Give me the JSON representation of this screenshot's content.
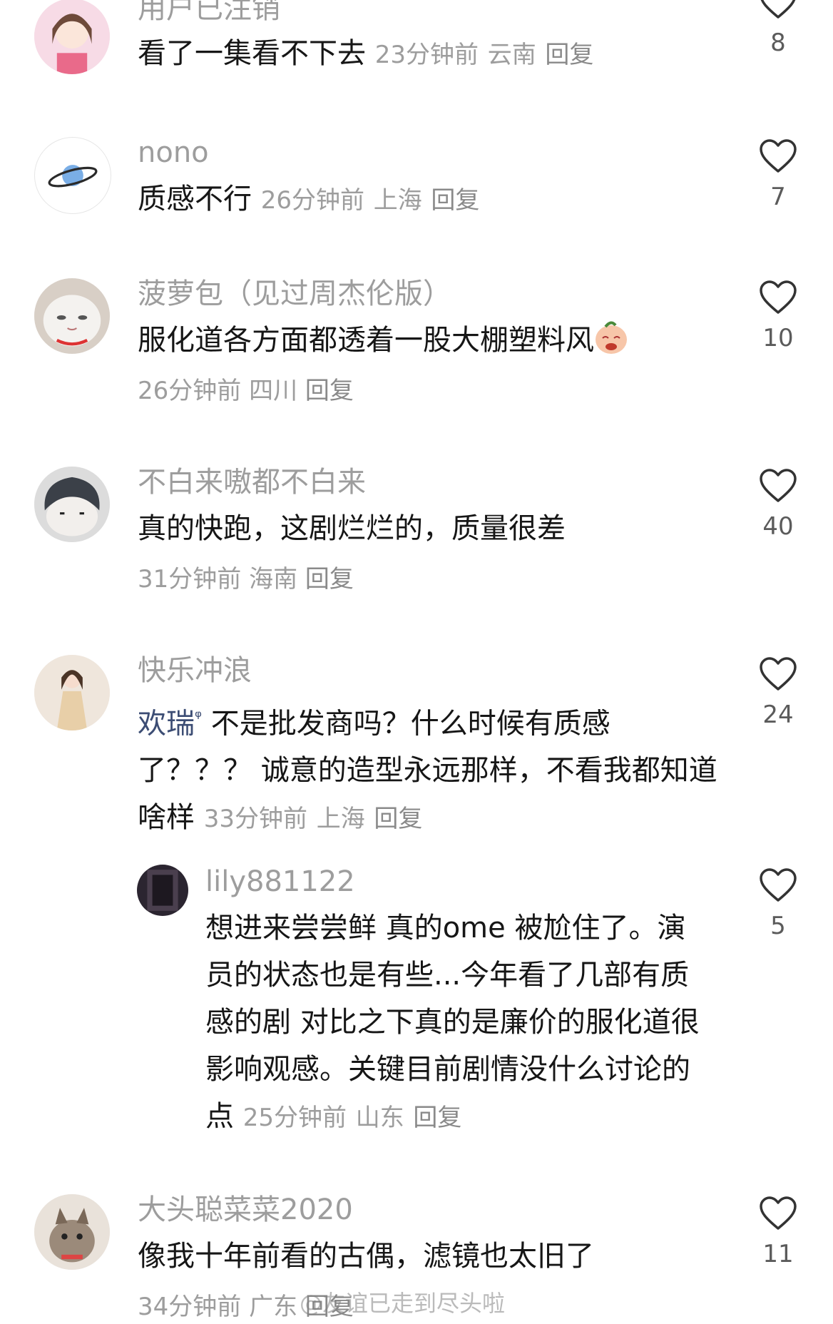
{
  "comments": [
    {
      "user": "用户已注销",
      "text": "看了一集看不下去",
      "time": "23分钟前",
      "region": "云南",
      "reply": "回复",
      "likes": "8"
    },
    {
      "user": "nono",
      "text": "质感不行",
      "time": "26分钟前",
      "region": "上海",
      "reply": "回复",
      "likes": "7"
    },
    {
      "user": "菠萝包（见过周杰伦版）",
      "text": "服化道各方面都透着一股大棚塑料风",
      "time": "26分钟前",
      "region": "四川",
      "reply": "回复",
      "likes": "10"
    },
    {
      "user": "不白来嗷都不白来",
      "text": "真的快跑，这剧烂烂的，质量很差",
      "time": "31分钟前",
      "region": "海南",
      "reply": "回复",
      "likes": "40"
    },
    {
      "user": "快乐冲浪",
      "mention": "欢瑞",
      "text_line1": " 不是批发商吗？什么时候有质感",
      "text_line2": "了？？？ 诚意的造型永远那样，不看我都知道",
      "text_line3": "啥样",
      "time": "33分钟前",
      "region": "上海",
      "reply": "回复",
      "likes": "24"
    },
    {
      "user": "lily881122",
      "text_line1": "想进来尝尝鲜 真的ome 被尬住了。演",
      "text_line2": "员的状态也是有些...今年看了几部有质",
      "text_line3": "感的剧 对比之下真的是廉价的服化道很",
      "text_line4": "影响观感。关键目前剧情没什么讨论的",
      "text_line5": "点",
      "time": "25分钟前",
      "region": "山东",
      "reply": "回复",
      "likes": "5"
    },
    {
      "user": "大头聪菜菜2020",
      "text": "像我十年前看的古偶，滤镜也太旧了",
      "time": "34分钟前",
      "region": "广东",
      "reply": "回复",
      "likes": "11"
    }
  ],
  "watermark": "@友谊已走到尽头啦",
  "icons": {
    "like": "heart-outline-icon"
  },
  "colors": {
    "username": "#9d9d9d",
    "text": "#161616",
    "mention": "#3c4d74"
  }
}
